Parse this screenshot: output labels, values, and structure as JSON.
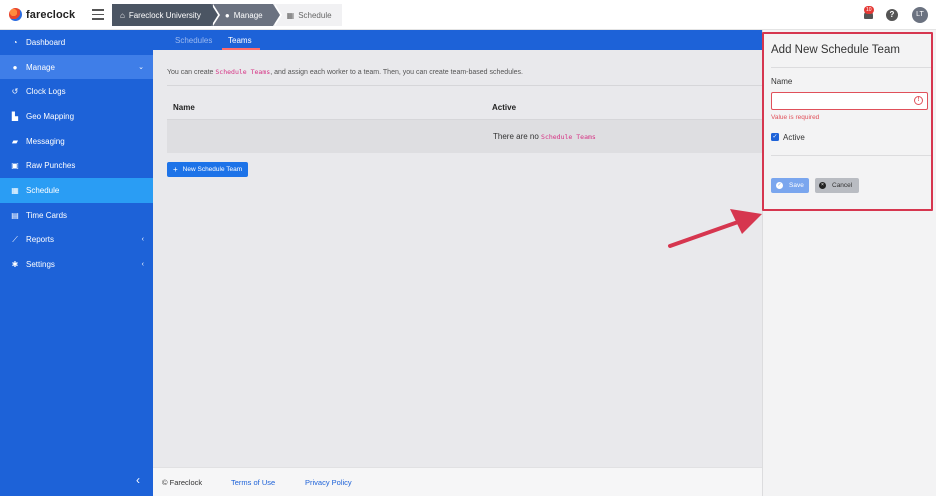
{
  "app": {
    "logo_text": "fareclock"
  },
  "breadcrumbs": [
    {
      "label": "Fareclock University",
      "icon": "home-icon"
    },
    {
      "label": "Manage",
      "icon": "user-icon"
    },
    {
      "label": "Schedule",
      "icon": "calendar-icon"
    }
  ],
  "header": {
    "notification_count": "10",
    "help_glyph": "?",
    "avatar_initials": "LT"
  },
  "sidebar": {
    "items": [
      {
        "label": "Dashboard",
        "icon": "dashboard-icon",
        "glyph": "◔"
      },
      {
        "label": "Manage",
        "icon": "user-icon",
        "glyph": "👤",
        "chevron": "⌄"
      },
      {
        "label": "Clock Logs",
        "icon": "history-icon",
        "glyph": "↺"
      },
      {
        "label": "Geo Mapping",
        "icon": "map-icon",
        "glyph": "▙"
      },
      {
        "label": "Messaging",
        "icon": "chat-icon",
        "glyph": "▰"
      },
      {
        "label": "Raw Punches",
        "icon": "punch-icon",
        "glyph": "▣"
      },
      {
        "label": "Schedule",
        "icon": "calendar-icon",
        "glyph": "▦"
      },
      {
        "label": "Time Cards",
        "icon": "timecard-icon",
        "glyph": "▤"
      },
      {
        "label": "Reports",
        "icon": "chart-icon",
        "glyph": "⟋",
        "chevron": "‹"
      },
      {
        "label": "Settings",
        "icon": "gear-icon",
        "glyph": "✱",
        "chevron": "‹"
      }
    ],
    "collapse_glyph": "‹"
  },
  "tabs": [
    {
      "label": "Schedules"
    },
    {
      "label": "Teams"
    }
  ],
  "main": {
    "intro_before": "You can create ",
    "intro_code": "Schedule Teams",
    "intro_after": ", and assign each worker to a team. Then, you can create team-based schedules.",
    "columns": [
      "Name",
      "Active"
    ],
    "empty_before": "There are no ",
    "empty_code": "Schedule Teams",
    "new_button": "New Schedule Team"
  },
  "footer": {
    "copyright": "© Fareclock",
    "terms": "Terms of Use",
    "privacy": "Privacy Policy"
  },
  "panel": {
    "title": "Add New Schedule Team",
    "name_label": "Name",
    "name_value": "",
    "name_placeholder": "",
    "error": "Value is required",
    "active_label": "Active",
    "active_checked": true,
    "save_label": "Save",
    "cancel_label": "Cancel"
  },
  "colors": {
    "sidebar": "#1d62d8",
    "active_item": "#2a9df4",
    "annotation": "#d6364f",
    "error": "#e0505a"
  }
}
